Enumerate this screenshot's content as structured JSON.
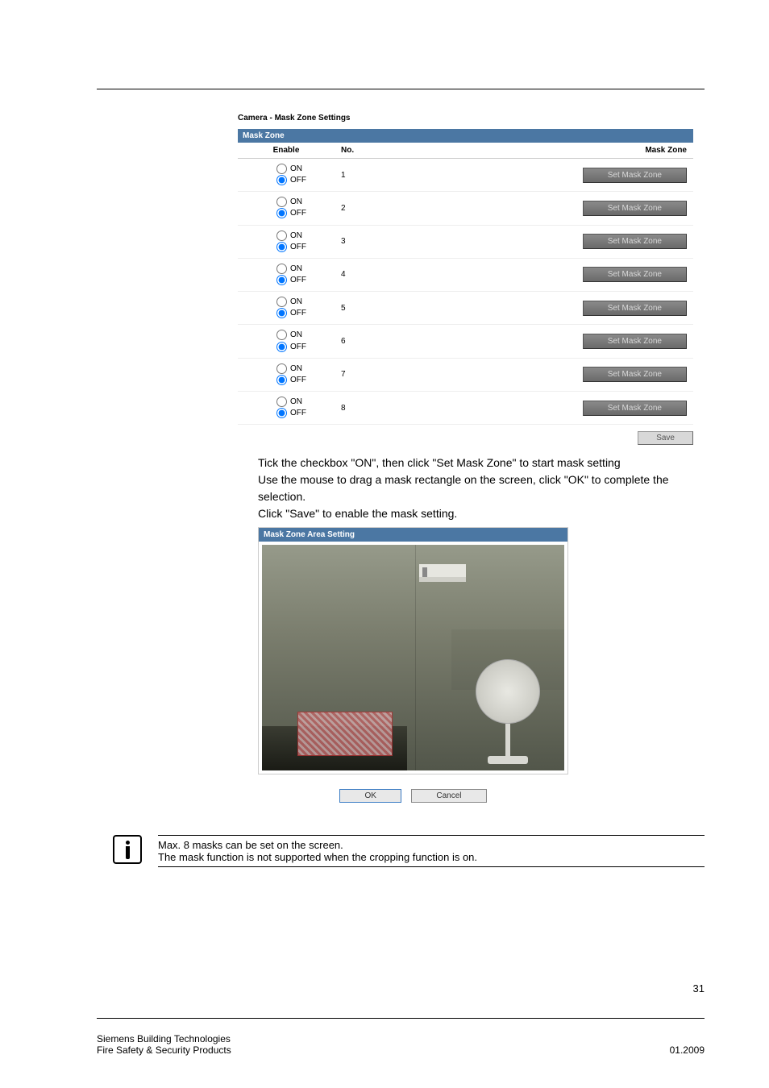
{
  "screenshot1": {
    "title": "Camera - Mask Zone Settings",
    "panel_title": "Mask Zone",
    "headers": {
      "enable": "Enable",
      "no": "No.",
      "zone": "Mask Zone"
    },
    "on_label": "ON",
    "off_label": "OFF",
    "rows": [
      {
        "no": "1",
        "btn": "Set Mask Zone"
      },
      {
        "no": "2",
        "btn": "Set Mask Zone"
      },
      {
        "no": "3",
        "btn": "Set Mask Zone"
      },
      {
        "no": "4",
        "btn": "Set Mask Zone"
      },
      {
        "no": "5",
        "btn": "Set Mask Zone"
      },
      {
        "no": "6",
        "btn": "Set Mask Zone"
      },
      {
        "no": "7",
        "btn": "Set Mask Zone"
      },
      {
        "no": "8",
        "btn": "Set Mask Zone"
      }
    ],
    "save": "Save"
  },
  "instructions": {
    "line1": "Tick the checkbox  \"ON\", then click \"Set Mask Zone\" to start mask setting",
    "line2": "Use the mouse to drag a mask rectangle on the screen, click \"OK\" to complete the selection.",
    "line3": "Click \"Save\" to enable the mask setting."
  },
  "screenshot2": {
    "title": "Mask Zone Area Setting",
    "ok": "OK",
    "cancel": "Cancel"
  },
  "note": {
    "line1": "Max. 8 masks can be set on the screen.",
    "line2": "The mask function is not supported when the cropping function is on."
  },
  "footer": {
    "left1": "Siemens Building Technologies",
    "left2": "Fire Safety & Security Products",
    "right": "01.2009",
    "page": "31"
  }
}
